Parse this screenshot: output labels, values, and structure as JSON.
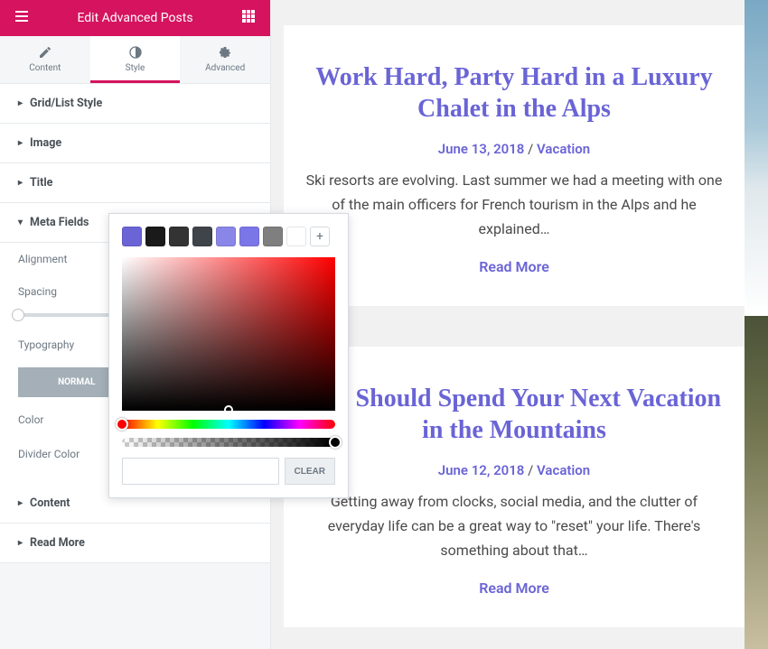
{
  "header": {
    "title": "Edit Advanced Posts"
  },
  "tabs": {
    "content": "Content",
    "style": "Style",
    "advanced": "Advanced"
  },
  "sections": {
    "gridlist": "Grid/List Style",
    "image": "Image",
    "title": "Title",
    "metafields": "Meta Fields",
    "content": "Content",
    "readmore": "Read More"
  },
  "meta": {
    "alignment": "Alignment",
    "spacing": "Spacing",
    "typography": "Typography",
    "toggle_normal": "NORMAL",
    "color": "Color",
    "divider_color": "Divider Color"
  },
  "color_popup": {
    "swatches": [
      "#6a64d6",
      "#1a1a1a",
      "#333333",
      "#3f444b",
      "#8a86e8",
      "#7b76e8",
      "#7f7f7f",
      "#ffffff"
    ],
    "clear": "CLEAR"
  },
  "posts": [
    {
      "title": "Work Hard, Party Hard in a Luxury Chalet in the Alps",
      "date": "June 13, 2018",
      "category": "Vacation",
      "excerpt": "Ski resorts are evolving. Last summer we had a meeting with one of the main officers for French tourism in the Alps and he explained…",
      "readmore": "Read More"
    },
    {
      "title": "You Should Spend Your Next Vacation in the Mountains",
      "date": "June 12, 2018",
      "category": "Vacation",
      "excerpt": "Getting away from clocks, social media, and the clutter of everyday life can be a great way to \"reset\" your life. There's something about that…",
      "readmore": "Read More"
    }
  ]
}
